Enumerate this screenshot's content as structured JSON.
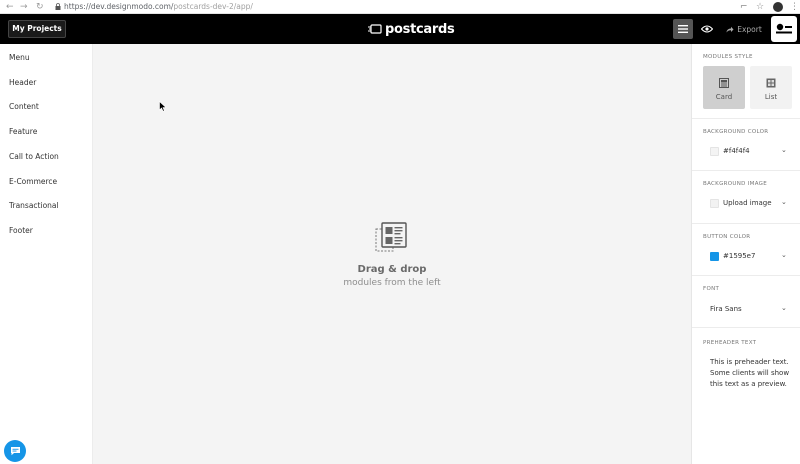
{
  "browser": {
    "back": "←",
    "forward": "→",
    "reload": "↻",
    "url_host": "https://dev.designmodo.com/",
    "url_path": "postcards-dev-2/app/"
  },
  "header": {
    "my_projects": "My Projects",
    "logo": "postcards",
    "export": "Export"
  },
  "sidebar": {
    "items": [
      "Menu",
      "Header",
      "Content",
      "Feature",
      "Call to Action",
      "E-Commerce",
      "Transactional",
      "Footer"
    ]
  },
  "canvas": {
    "title": "Drag & drop",
    "subtitle": "modules from the left"
  },
  "panel": {
    "modules_style": {
      "label": "MODULES STYLE",
      "options": [
        "Card",
        "List"
      ],
      "selected": "Card"
    },
    "background_color": {
      "label": "BACKGROUND COLOR",
      "value": "#f4f4f4"
    },
    "background_image": {
      "label": "BACKGROUND IMAGE",
      "value": "Upload image"
    },
    "button_color": {
      "label": "BUTTON COLOR",
      "value": "#1595e7"
    },
    "font": {
      "label": "FONT",
      "value": "Fira Sans"
    },
    "preheader": {
      "label": "PREHEADER TEXT",
      "value": "This is preheader text. Some clients will show this text as a preview."
    }
  },
  "colors": {
    "accent": "#1595e7",
    "header_bg": "#000000",
    "canvas_bg": "#f4f4f4"
  },
  "icons": [
    "lock-icon",
    "menu-icon",
    "eye-icon",
    "share-icon",
    "user-icon",
    "drag-drop-icon",
    "card-icon",
    "list-icon",
    "chevron-down-icon",
    "chat-icon"
  ]
}
